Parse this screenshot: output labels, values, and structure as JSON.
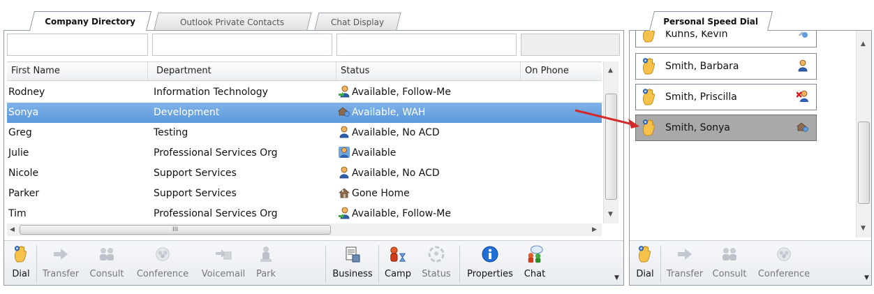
{
  "tabs": {
    "left": [
      {
        "label": "Company Directory",
        "active": true
      },
      {
        "label": "Outlook Private Contacts",
        "active": false
      },
      {
        "label": "Chat Display",
        "active": false
      }
    ],
    "right": {
      "label": "Personal Speed Dial",
      "active": true
    }
  },
  "directory": {
    "filters": [
      "",
      "",
      "",
      ""
    ],
    "columns": [
      "First Name",
      "Department",
      "Status",
      "On Phone"
    ],
    "rows": [
      {
        "first_name": "Rodney",
        "department": "Information Technology",
        "status_icon": "follow-me-user-icon",
        "status": "Available, Follow-Me",
        "on_phone": "",
        "selected": false
      },
      {
        "first_name": "Sonya",
        "department": "Development",
        "status_icon": "home-work-icon",
        "status": "Available, WAH",
        "on_phone": "",
        "selected": true
      },
      {
        "first_name": "Greg",
        "department": "Testing",
        "status_icon": "user-icon",
        "status": "Available, No ACD",
        "on_phone": "",
        "selected": false
      },
      {
        "first_name": "Julie",
        "department": "Professional Services Org",
        "status_icon": "user-available-icon",
        "status": "Available",
        "on_phone": "",
        "selected": false
      },
      {
        "first_name": "Nicole",
        "department": "Support Services",
        "status_icon": "user-icon",
        "status": "Available, No ACD",
        "on_phone": "",
        "selected": false
      },
      {
        "first_name": "Parker",
        "department": "Support Services",
        "status_icon": "home-icon",
        "status": "Gone Home",
        "on_phone": "",
        "selected": false
      },
      {
        "first_name": "Tim",
        "department": "Professional Services Org",
        "status_icon": "follow-me-user-icon",
        "status": "Available, Follow-Me",
        "on_phone": "",
        "selected": false
      }
    ],
    "hscroll_marker": "III"
  },
  "left_toolbar": {
    "buttons": [
      {
        "id": "dial",
        "label": "Dial",
        "icon": "hand-phone-icon",
        "enabled": true
      },
      {
        "id": "transfer",
        "label": "Transfer",
        "icon": "arrow-right-icon",
        "enabled": false
      },
      {
        "id": "consult",
        "label": "Consult",
        "icon": "consult-icon",
        "enabled": false
      },
      {
        "id": "conference",
        "label": "Conference",
        "icon": "conference-icon",
        "enabled": false
      },
      {
        "id": "voicemail",
        "label": "Voicemail",
        "icon": "voicemail-icon",
        "enabled": false
      },
      {
        "id": "park",
        "label": "Park",
        "icon": "park-icon",
        "enabled": false
      },
      {
        "id": "business",
        "label": "Business",
        "icon": "business-card-icon",
        "enabled": true
      },
      {
        "id": "camp",
        "label": "Camp",
        "icon": "camp-icon",
        "enabled": true
      },
      {
        "id": "status",
        "label": "Status",
        "icon": "status-icon",
        "enabled": false
      },
      {
        "id": "properties",
        "label": "Properties",
        "icon": "info-icon",
        "enabled": true
      },
      {
        "id": "chat",
        "label": "Chat",
        "icon": "chat-icon",
        "enabled": true
      }
    ]
  },
  "speed_dial": {
    "items": [
      {
        "name": "Kuhns, Kevin",
        "status_icon": "phone-status-icon",
        "highlight": false
      },
      {
        "name": "Smith, Barbara",
        "status_icon": "user-icon",
        "highlight": false
      },
      {
        "name": "Smith, Priscilla",
        "status_icon": "user-unavailable-icon",
        "highlight": false
      },
      {
        "name": "Smith, Sonya",
        "status_icon": "home-work-icon",
        "highlight": true
      }
    ]
  },
  "right_toolbar": {
    "buttons": [
      {
        "id": "dial",
        "label": "Dial",
        "icon": "hand-phone-icon",
        "enabled": true
      },
      {
        "id": "transfer",
        "label": "Transfer",
        "icon": "arrow-right-icon",
        "enabled": false
      },
      {
        "id": "consult",
        "label": "Consult",
        "icon": "consult-icon",
        "enabled": false
      },
      {
        "id": "conference",
        "label": "Conference",
        "icon": "conference-icon",
        "enabled": false
      }
    ]
  },
  "annotation": {
    "arrow_color": "#d22a2a"
  },
  "colors": {
    "selected_row": "#6aa3e0",
    "panel_border": "#8e9aa6",
    "speed_highlight": "#a9a9a9"
  }
}
